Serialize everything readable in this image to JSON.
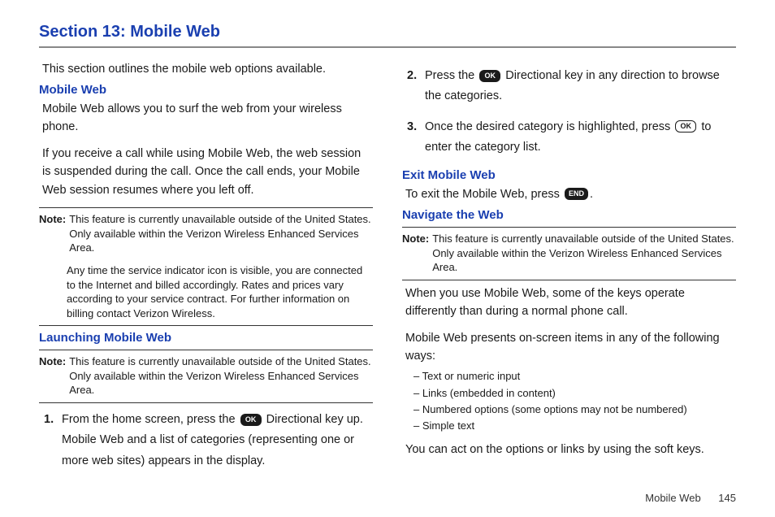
{
  "section_title": "Section 13: Mobile Web",
  "left": {
    "intro": "This section outlines the mobile web options available.",
    "h_mobile_web": "Mobile Web",
    "mw_p1": "Mobile Web allows you to surf the web from your wireless phone.",
    "mw_p2": "If you receive a call while using Mobile Web, the web session is suspended during the call. Once the call ends, your Mobile Web session resumes where you left off.",
    "note1_label": "Note:",
    "note1_text": "This feature is currently unavailable outside of the United States. Only available within the Verizon Wireless Enhanced Services Area.",
    "note1_extra": "Any time the service indicator icon is visible, you are connected to the Internet and billed accordingly. Rates and prices vary according to your service contract. For further information on billing contact Verizon Wireless.",
    "h_launching": "Launching Mobile Web",
    "note2_label": "Note:",
    "note2_text": "This feature is currently unavailable outside of the United States. Only available within the Verizon Wireless Enhanced Services Area.",
    "step1_num": "1.",
    "step1_a": "From the home screen, press the ",
    "step1_key": "OK",
    "step1_b": " Directional key up. Mobile Web and a list of categories (representing one or more web sites) appears in the display."
  },
  "right": {
    "step2_num": "2.",
    "step2_a": "Press the ",
    "step2_key": "OK",
    "step2_b": " Directional key in any direction to browse the categories.",
    "step3_num": "3.",
    "step3_a": "Once the desired category is highlighted, press ",
    "step3_key": "OK",
    "step3_b": " to enter the category list.",
    "h_exit": "Exit Mobile Web",
    "exit_a": "To exit the Mobile Web, press ",
    "exit_key": "END",
    "exit_b": ".",
    "h_navigate": "Navigate the Web",
    "note3_label": "Note:",
    "note3_text": "This feature is currently unavailable outside of the United States. Only available within the Verizon Wireless Enhanced Services Area.",
    "nav_p1": "When you use Mobile Web, some of the keys operate differently than during a normal phone call.",
    "nav_p2": "Mobile Web presents on-screen items in any of the following ways:",
    "dash": {
      "d1": "Text or numeric input",
      "d2": "Links (embedded in content)",
      "d3": "Numbered options (some options may not be numbered)",
      "d4": "Simple text"
    },
    "nav_p3": "You can act on the options or links by using the soft keys."
  },
  "footer": {
    "label": "Mobile Web",
    "page": "145"
  }
}
